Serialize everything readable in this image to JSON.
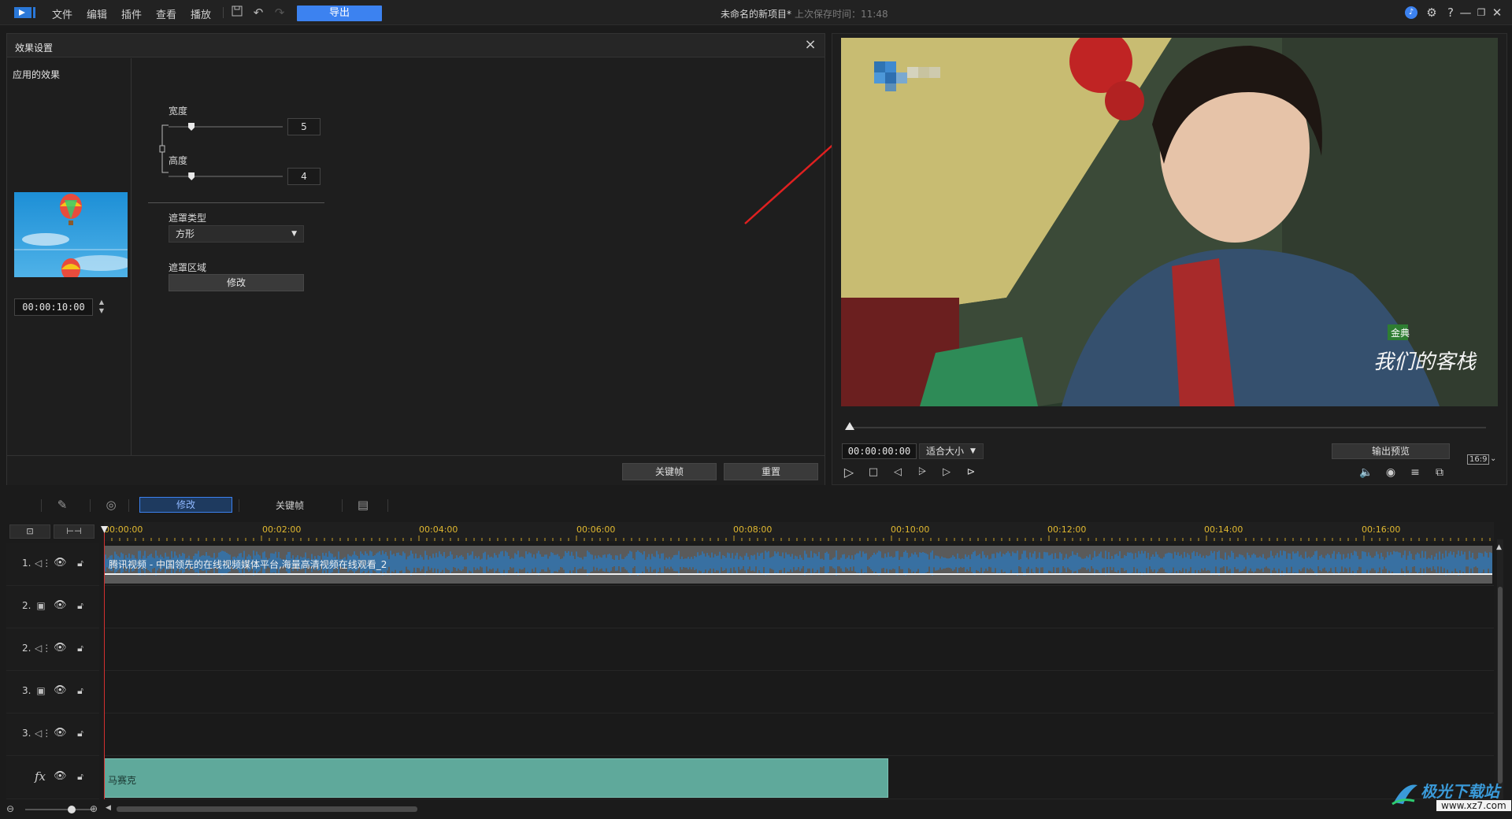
{
  "app": {
    "menu": [
      "文件",
      "编辑",
      "插件",
      "查看",
      "播放"
    ],
    "export_label": "导出",
    "project_title": "未命名的新项目*",
    "save_status": "上次保存时间：11:48"
  },
  "effect_panel": {
    "title": "效果设置",
    "applied_effects_label": "应用的效果",
    "timecode": "00:00:10:00",
    "width_label": "宽度",
    "width_value": "5",
    "width_level": 0.2,
    "height_label": "高度",
    "height_value": "4",
    "height_level": 0.16,
    "mask_type_label": "遮罩类型",
    "mask_type_value": "方形",
    "mask_area_label": "遮罩区域",
    "mask_area_button": "修改",
    "keyframe_button": "关键帧",
    "reset_button": "重置"
  },
  "preview": {
    "timecode": "00:00:00:00",
    "fit_label": "适合大小",
    "output_preview": "输出预览",
    "aspect_ratio": "16:9"
  },
  "timeline_toolbar": {
    "modify_label": "修改",
    "keyframe_label": "关键帧"
  },
  "ruler": {
    "ticks": [
      "00:00:00",
      "00:02:00",
      "00:04:00",
      "00:06:00",
      "00:08:00",
      "00:10:00",
      "00:12:00",
      "00:14:00",
      "00:16:00"
    ]
  },
  "tracks": [
    {
      "num": "1.",
      "type": "audio"
    },
    {
      "num": "2.",
      "type": "video"
    },
    {
      "num": "2.",
      "type": "audio"
    },
    {
      "num": "3.",
      "type": "video"
    },
    {
      "num": "3.",
      "type": "audio"
    },
    {
      "num": "fx",
      "type": "fx"
    }
  ],
  "clips": {
    "audio_clip_label": "腾讯视频 - 中国领先的在线视频媒体平台,海量高清视频在线观看_2",
    "fx_clip_label": "马赛克"
  },
  "watermark": {
    "text": "极光下载站",
    "url": "www.xz7.com"
  },
  "colors": {
    "accent": "#3c82f0",
    "playhead": "#d23030",
    "fx_clip": "#5fa99b",
    "ruler_text": "#e0b830"
  }
}
